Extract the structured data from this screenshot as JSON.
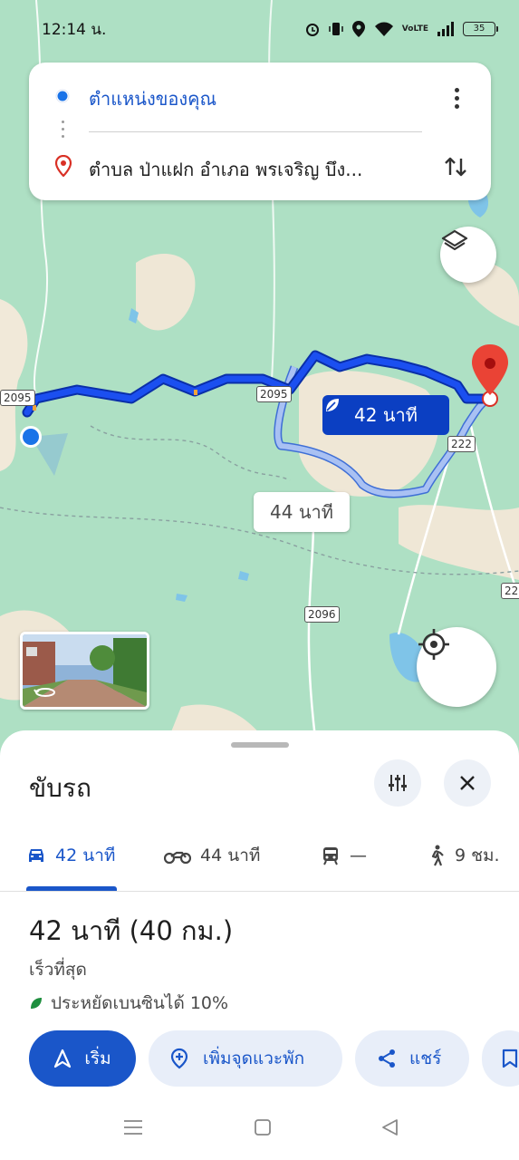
{
  "status_bar": {
    "time": "12:14 น.",
    "battery": "35",
    "network": "VoLTE"
  },
  "route_card": {
    "origin": "ตำแหน่งของคุณ",
    "destination": "ตำบล ป่าแฝก อำเภอ พรเจริญ บึง..."
  },
  "map": {
    "road_labels": [
      "2095",
      "2095",
      "222",
      "2096",
      "22"
    ],
    "eta_fast": "42 นาที",
    "eta_slow": "44 นาที"
  },
  "sheet": {
    "title": "ขับรถ",
    "modes": [
      {
        "name": "drive",
        "label": "42 นาที"
      },
      {
        "name": "motorcycle",
        "label": "44 นาที"
      },
      {
        "name": "transit",
        "label": "—"
      },
      {
        "name": "walk",
        "label": "9 ชม."
      }
    ],
    "summary_title": "42 นาที (40 กม.)",
    "summary_sub": "เร็วที่สุด",
    "eco_text": "ประหยัดเบนซินได้ 10%",
    "actions": {
      "start": "เริ่ม",
      "add_stop": "เพิ่มจุดแวะพัก",
      "share": "แชร์"
    }
  },
  "colors": {
    "accent": "#1a56c9",
    "route_primary": "#0b3fc2",
    "route_alt": "#9fb8f0",
    "map_bg": "#aee0c4",
    "pin": "#d93025"
  }
}
